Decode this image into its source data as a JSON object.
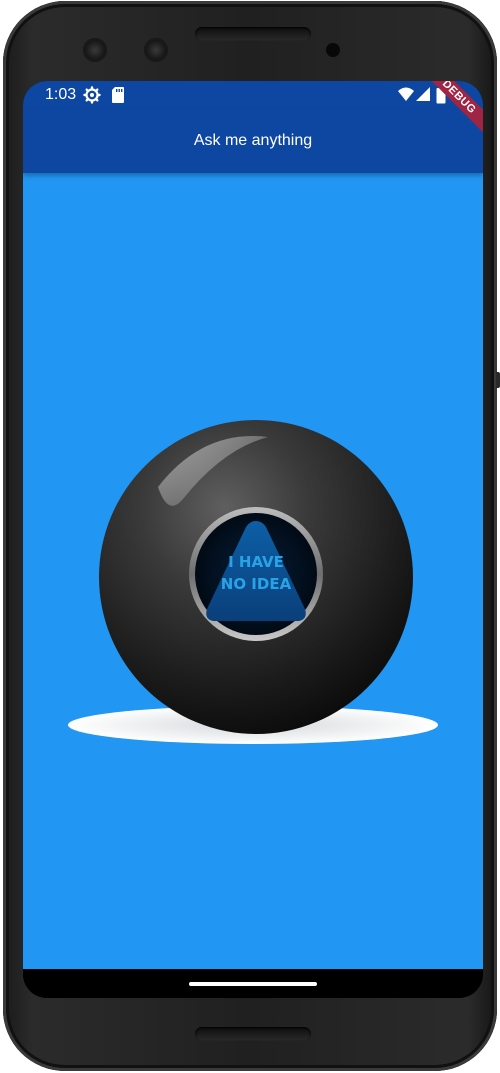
{
  "status_bar": {
    "time": "1:03",
    "icons": [
      "settings-gear-icon",
      "sd-card-icon",
      "wifi-icon",
      "cell-signal-icon",
      "battery-icon"
    ]
  },
  "app_bar": {
    "title": "Ask me anything"
  },
  "debug_banner": {
    "label": "DEBUG"
  },
  "ball": {
    "answer_line1": "I HAVE",
    "answer_line2": "NO IDEA"
  },
  "colors": {
    "app_bar": "#0d47a1",
    "background": "#2196f3",
    "debug_banner": "#a02545",
    "ball_text": "#29a3e8"
  }
}
